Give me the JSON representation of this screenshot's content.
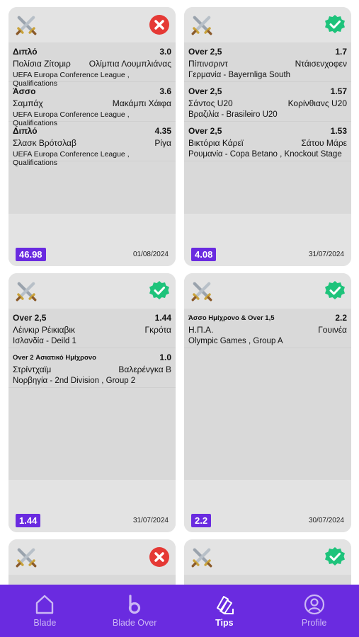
{
  "cards": [
    {
      "status": "lost",
      "bets": [
        {
          "market": "Διπλό",
          "odds": "3.0",
          "home": "Πολίσια Ζίτομιρ",
          "away": "Ολίμπια Λουμπλιάνας",
          "league": "UEFA Europa Conference League , Qualifications"
        },
        {
          "market": "Άσσο",
          "odds": "3.6",
          "home": "Σαμπάχ",
          "away": "Μακάμπι Χάιφα",
          "league": "UEFA Europa Conference League , Qualifications"
        },
        {
          "market": "Διπλό",
          "odds": "4.35",
          "home": "Σλασκ Βρότσλαβ",
          "away": "Ρίγα",
          "league": "UEFA Europa Conference League , Qualifications"
        }
      ],
      "total": "46.98",
      "date": "01/08/2024"
    },
    {
      "status": "won",
      "bets": [
        {
          "market": "Over 2,5",
          "odds": "1.7",
          "home": "Πίπινσριντ",
          "away": "Ντάισενχοφεν",
          "league": "Γερμανία - Bayernliga South"
        },
        {
          "market": "Over 2,5",
          "odds": "1.57",
          "home": "Σάντος U20",
          "away": "Κορίνθιανς U20",
          "league": "Βραζιλία - Brasileiro U20"
        },
        {
          "market": "Over 2,5",
          "odds": "1.53",
          "home": "Βικτόρια Κάρεϊ",
          "away": "Σάτου Μάρε",
          "league": "Ρουμανία - Copa Betano , Knockout Stage"
        }
      ],
      "total": "4.08",
      "date": "31/07/2024"
    },
    {
      "status": "won",
      "bets": [
        {
          "market": "Over 2,5",
          "odds": "1.44",
          "home": "Λέινκιρ Ρέικιαβικ",
          "away": "Γκρότα",
          "league": "Ισλανδία - Deild 1"
        },
        {
          "market": "Over 2 Ασιατικό Ημίχρονο",
          "odds": "1.0",
          "home": "Στρίντχαϊμ",
          "away": "Βαλερένγκα Β",
          "league": "Νορβηγία - 2nd Division , Group 2"
        }
      ],
      "total": "1.44",
      "date": "31/07/2024"
    },
    {
      "status": "won",
      "bets": [
        {
          "market": "Άσσο Ημίχρονο & Over 1,5",
          "odds": "2.2",
          "home": "Η.Π.Α.",
          "away": "Γουινέα",
          "league": "Olympic Games , Group A"
        }
      ],
      "total": "2.2",
      "date": "30/07/2024"
    },
    {
      "status": "lost",
      "bets": [],
      "total": "",
      "date": ""
    },
    {
      "status": "won",
      "bets": [],
      "total": "",
      "date": ""
    }
  ],
  "nav": [
    {
      "label": "Blade",
      "icon": "home-icon",
      "active": false
    },
    {
      "label": "Blade Over",
      "icon": "blade-b-icon",
      "active": false
    },
    {
      "label": "Tips",
      "icon": "tips-cards-icon",
      "active": true
    },
    {
      "label": "Profile",
      "icon": "profile-icon",
      "active": false
    }
  ],
  "colors": {
    "accent": "#6a2be0",
    "won": "#1ec37b",
    "lost": "#e53935"
  }
}
